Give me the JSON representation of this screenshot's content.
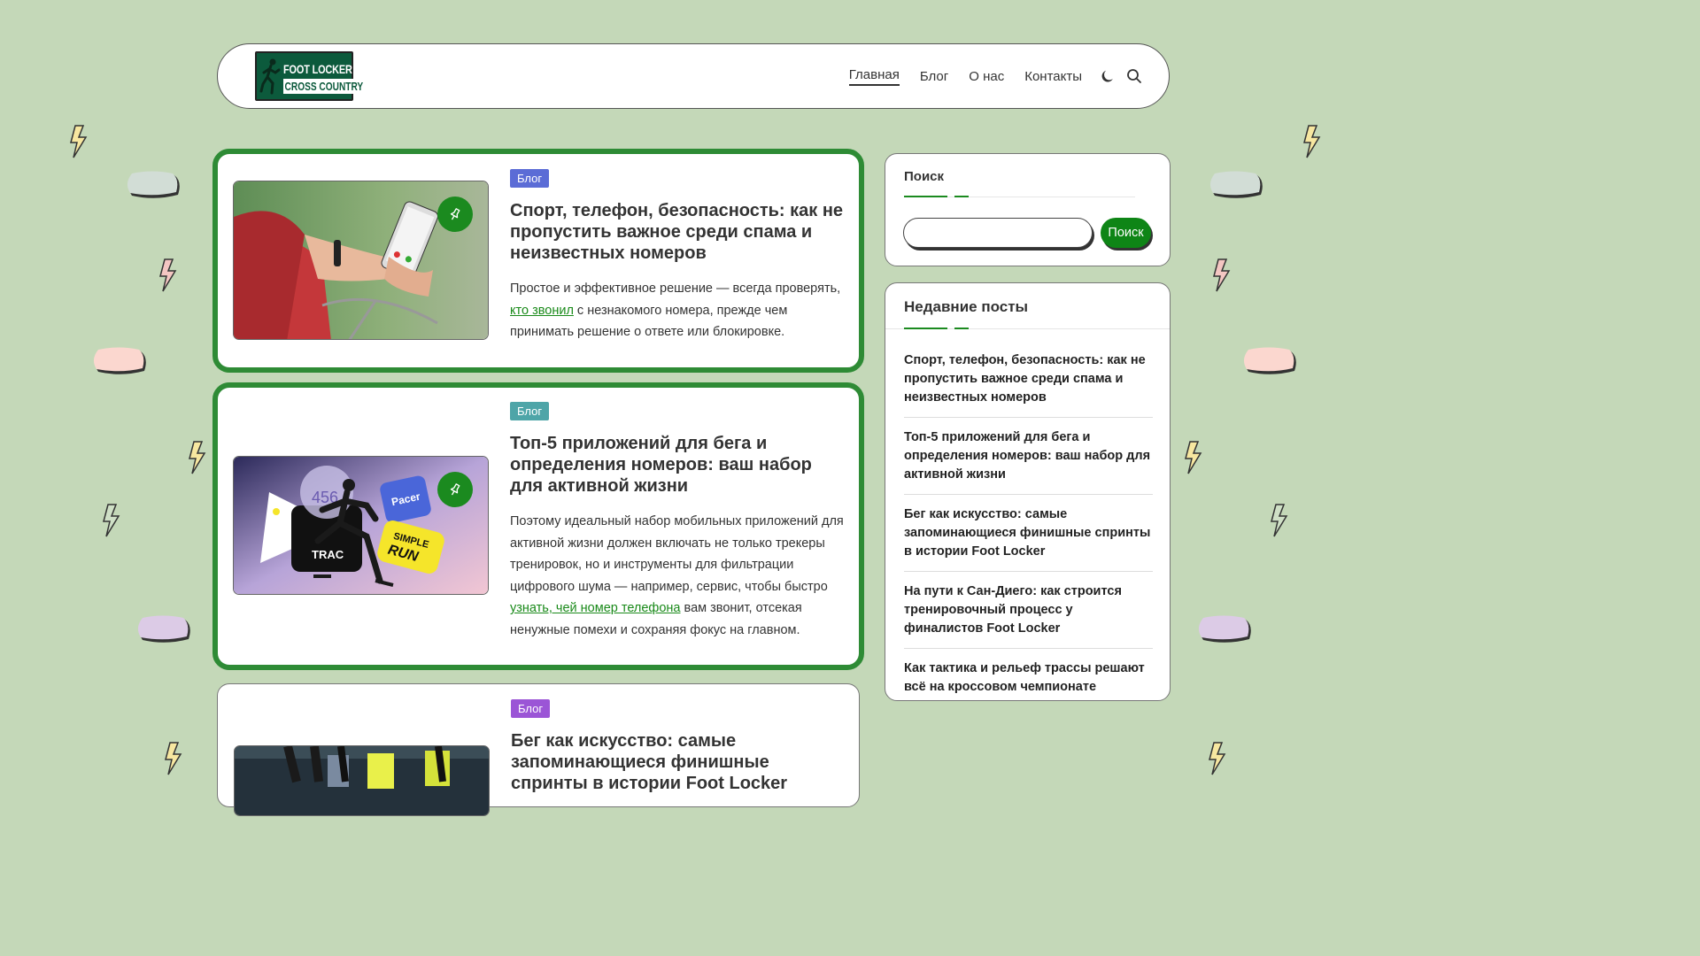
{
  "logo": {
    "line1": "FOOT LOCKER",
    "line2": "CROSS COUNTRY"
  },
  "nav": {
    "items": [
      {
        "label": "Главная"
      },
      {
        "label": "Блог"
      },
      {
        "label": "О нас"
      },
      {
        "label": "Контакты"
      }
    ],
    "theme_icon": "moon-icon",
    "search_icon": "search-icon"
  },
  "posts": [
    {
      "tag": "Блог",
      "tag_color": "#5b6cd6",
      "title": "Спорт, телефон, безопасность: как не пропустить важное среди спама и неизвестных номеров",
      "excerpt_before": "Простое и эффективное решение — всегда проверять, ",
      "link_text": "кто звонил",
      "excerpt_after": " с незнакомого номера, прежде чем принимать решение о ответе или блокировке."
    },
    {
      "tag": "Блог",
      "tag_color": "#4ea5a8",
      "title": "Топ-5 приложений для бега и определения номеров: ваш набор для активной жизни",
      "excerpt_before": "Поэтому идеальный набор мобильных приложений для активной жизни должен включать не только трекеры тренировок, но и инструменты для фильтрации цифрового шума — например, сервис, чтобы быстро ",
      "link_text": "узнать, чей номер телефона",
      "excerpt_after": " вам звонит, отсекая ненужные помехи и сохраняя фокус на главном.",
      "image_labels": {
        "chip": "Pacer",
        "badge_top": "SIMPLE",
        "badge_bottom": "RUN",
        "tile": "TRAC",
        "number": "456"
      }
    },
    {
      "tag": "Блог",
      "tag_color": "#9b55d6",
      "title": "Бег как искусство: самые запоминающиеся финишные спринты в истории Foot Locker"
    }
  ],
  "sidebar": {
    "search": {
      "title": "Поиск",
      "button": "Поиск"
    },
    "recent": {
      "title": "Недавние посты",
      "items": [
        "Спорт, телефон, безопасность: как не пропустить важное среди спама и неизвестных номеров",
        "Топ-5 приложений для бега и определения номеров: ваш набор для активной жизни",
        "Бег как искусство: самые запоминающиеся финишные спринты в истории Foot Locker",
        "На пути к Сан-Диего: как строится тренировочный процесс у финалистов Foot Locker",
        "Как тактика и рельеф трассы решают всё на кроссовом чемпионате"
      ]
    }
  },
  "colors": {
    "page_bg": "#c4d8b8",
    "accent": "#1b8a1f",
    "highlight_border": "#2e8b35"
  }
}
